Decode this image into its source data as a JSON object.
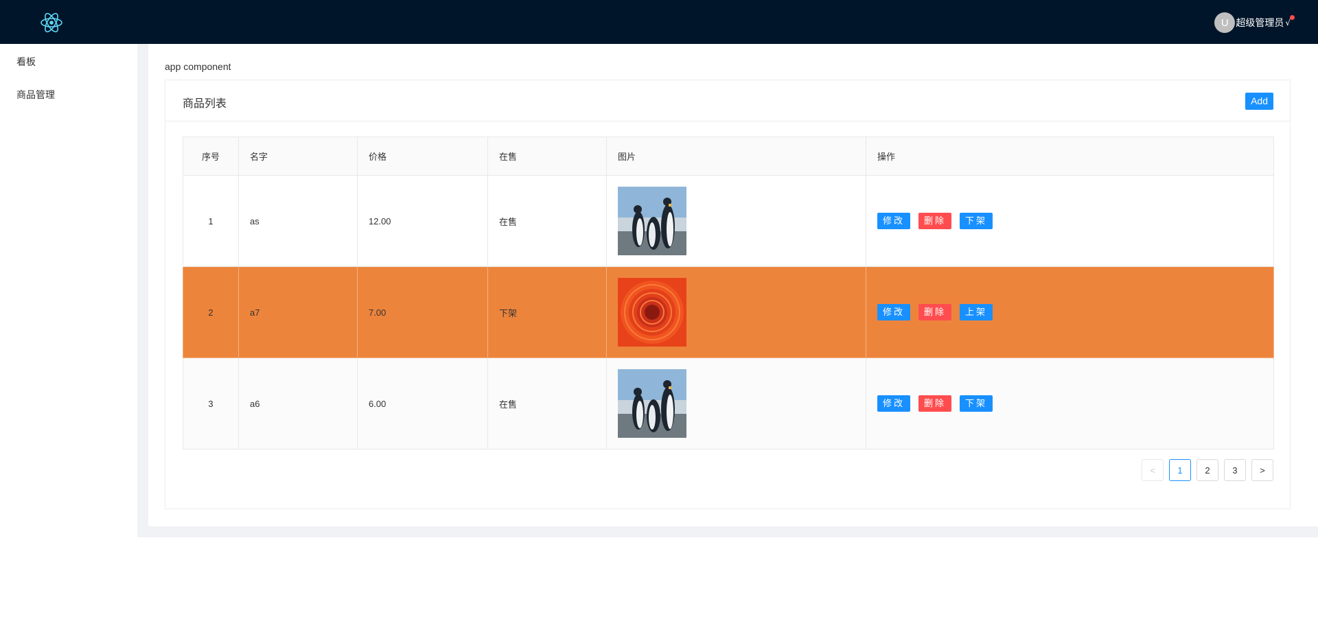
{
  "header": {
    "user_initial": "U",
    "username": "超级管理员",
    "chevron": "√"
  },
  "sidebar": {
    "items": [
      {
        "label": "看板"
      },
      {
        "label": "商品管理"
      }
    ]
  },
  "main": {
    "app_title": "app component",
    "card_title": "商品列表",
    "add_label": "Add",
    "columns": [
      "序号",
      "名字",
      "价格",
      "在售",
      "图片",
      "操作"
    ],
    "rows": [
      {
        "index": "1",
        "name": "as",
        "price": "12.00",
        "status": "在售",
        "image": "penguins",
        "edit": "修改",
        "delete": "删除",
        "toggle": "下架"
      },
      {
        "index": "2",
        "name": "a7",
        "price": "7.00",
        "status": "下架",
        "image": "red-flower",
        "edit": "修改",
        "delete": "删除",
        "toggle": "上架"
      },
      {
        "index": "3",
        "name": "a6",
        "price": "6.00",
        "status": "在售",
        "image": "penguins",
        "edit": "修改",
        "delete": "删除",
        "toggle": "下架"
      }
    ],
    "pagination": {
      "prev": "<",
      "pages": [
        "1",
        "2",
        "3"
      ],
      "next": ">",
      "current": "1"
    }
  },
  "colors": {
    "header_bg": "#001529",
    "primary": "#1890ff",
    "danger": "#ff4d4f",
    "highlight_row": "#ed843c"
  }
}
